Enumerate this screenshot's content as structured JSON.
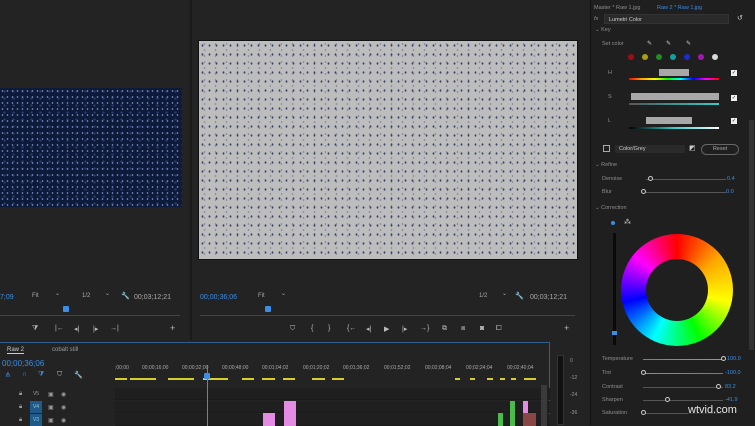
{
  "source_monitor": {
    "timecode": "7;09",
    "zoom": "Fit",
    "resolution": "1/2",
    "duration": "00;03;12;21"
  },
  "program_monitor": {
    "timecode": "00;00;36;06",
    "zoom": "Fit",
    "resolution": "1/2",
    "duration": "00;03;12;21"
  },
  "timeline": {
    "tabs": [
      "Raw 2",
      "cobalt still"
    ],
    "timecode": "00;00;36;06",
    "ruler": [
      ";00;00",
      "00;00;16;00",
      "00;00;32;00",
      "00;00;48;00",
      "00;01;04;02",
      "00;01;20;02",
      "00;01;36;02",
      "00;01;52;02",
      "00;02;08;04",
      "00;02;24;04",
      "00;02;40;04"
    ],
    "tracks": [
      "V5",
      "V4",
      "V3"
    ]
  },
  "audio_meter": {
    "labels": [
      "0",
      "-12",
      "-24",
      "-36"
    ]
  },
  "lumetri": {
    "tab_master": "Master * Raw 1.jpg",
    "tab_active": "Raw 2 * Raw 1.jpg",
    "fx_label": "fx",
    "effect": "Lumetri Color",
    "key_section": "Key",
    "set_color": "Set color",
    "swatches": [
      "#9b1010",
      "#a8a010",
      "#1e8f1e",
      "#14a0a0",
      "#1a2cd6",
      "#a218b0",
      "#d8d8d8"
    ],
    "h": "H",
    "s": "S",
    "l": "L",
    "mode": "Color/Grey",
    "reset": "Reset",
    "refine_section": "Refine",
    "denoise_label": "Denoise",
    "denoise_value": "0.4",
    "blur_label": "Blur",
    "blur_value": "0.0",
    "correction_section": "Correction",
    "temperature_label": "Temperature",
    "temperature_value": "100.0",
    "tint_label": "Tint",
    "tint_value": "-100.0",
    "contrast_label": "Contrast",
    "contrast_value": "83.2",
    "sharpen_label": "Sharpen",
    "sharpen_value": "-41.9",
    "saturation_label": "Saturation"
  },
  "watermark": "wtvid.com"
}
